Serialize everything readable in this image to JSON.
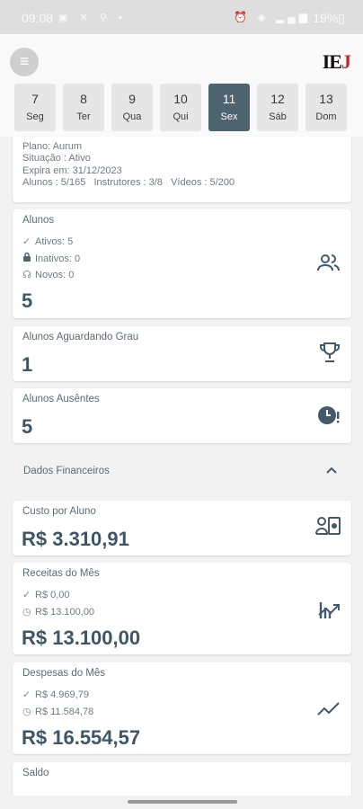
{
  "status_bar": {
    "time": "09:08",
    "left_icons": "▣ ✕ ⚲ •",
    "right_icons": "⏰ ◈ ▂▄▆",
    "battery": "19%▯"
  },
  "header": {
    "menu_icon": "menu-icon",
    "logo_main": "IE",
    "logo_accent": "J"
  },
  "days": [
    {
      "num": "7",
      "label": "Seg"
    },
    {
      "num": "8",
      "label": "Ter"
    },
    {
      "num": "9",
      "label": "Qua"
    },
    {
      "num": "10",
      "label": "Qui"
    },
    {
      "num": "11",
      "label": "Sex",
      "active": true
    },
    {
      "num": "12",
      "label": "Sáb"
    },
    {
      "num": "13",
      "label": "Dom"
    }
  ],
  "plan": {
    "plano": "Plano: Aurum",
    "situacao": "Situação : Ativo",
    "expira": "Expira em: 31/12/2023",
    "limites": "Alunos : 5/165   Instrutores : 3/8   Vídeos : 5/200"
  },
  "alunos": {
    "title": "Alunos",
    "ativos": "Ativos: 5",
    "inativos": "Inativos: 0",
    "novos": "Novos: 0",
    "total": "5"
  },
  "aguardando": {
    "title": "Alunos Aguardando Grau",
    "total": "1"
  },
  "ausentes": {
    "title": "Alunos Ausêntes",
    "total": "5"
  },
  "financeiro": {
    "section_title": "Dados Financeiros",
    "custo": {
      "title": "Custo por Aluno",
      "value": "R$ 3.310,91"
    },
    "receitas": {
      "title": "Receitas do Mês",
      "pago": "R$ 0,00",
      "pendente": "R$ 13.100,00",
      "value": "R$ 13.100,00"
    },
    "despesas": {
      "title": "Despesas do Mês",
      "pago": "R$ 4.969,79",
      "pendente": "R$ 11.584,78",
      "value": "R$ 16.554,57"
    },
    "saldo": {
      "title": "Saldo"
    }
  },
  "colors": {
    "accent": "#4d6370",
    "value_text": "#3e5665",
    "logo_red": "#c0282b"
  }
}
